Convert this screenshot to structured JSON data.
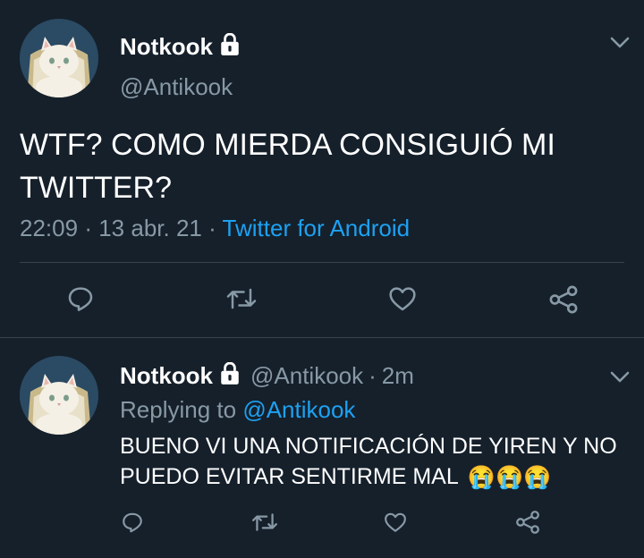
{
  "tweet": {
    "display_name": "Notkook",
    "handle": "@Antikook",
    "text": "WTF? COMO MIERDA CONSIGUIÓ MI TWITTER?",
    "time": "22:09",
    "sep1": "·",
    "date": "13 abr. 21",
    "sep2": "·",
    "source": "Twitter for Android",
    "actions": [
      "reply-icon",
      "retweet-icon",
      "like-icon",
      "share-icon"
    ]
  },
  "reply": {
    "display_name": "Notkook",
    "handle": "@Antikook",
    "sep": "·",
    "age": "2m",
    "replying_prefix": "Replying to",
    "replying_to": "@Antikook",
    "text": "BUENO VI UNA NOTIFICACIÓN DE YIREN Y NO PUEDO EVITAR SENTIRME MAL",
    "emojis": [
      "😭",
      "😭",
      "😭"
    ],
    "actions": [
      "reply-icon",
      "retweet-icon",
      "like-icon",
      "share-icon"
    ]
  },
  "colors": {
    "background": "#15202b",
    "secondary_text": "#8899a6",
    "link": "#1da1f2",
    "divider": "#38444d"
  }
}
